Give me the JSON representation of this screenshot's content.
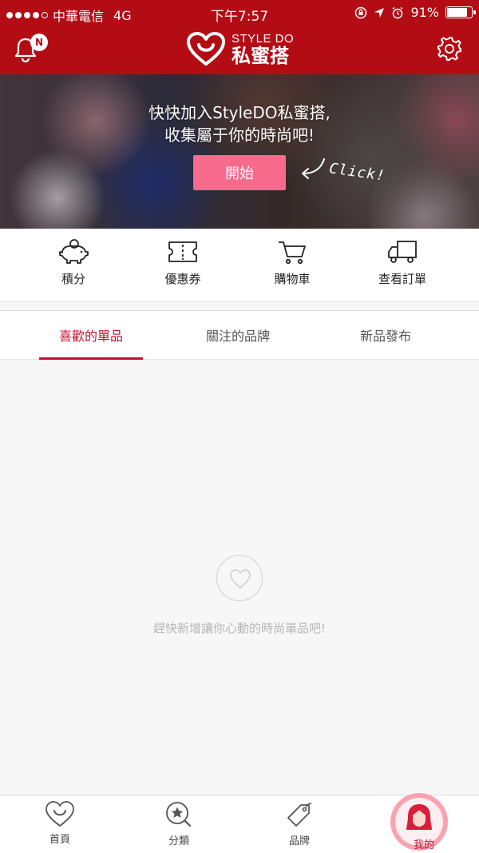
{
  "status_bar": {
    "carrier": "中華電信",
    "network": "4G",
    "time": "下午7:57",
    "battery": "91%",
    "battery_level": 0.91
  },
  "nav": {
    "notification_badge": "N",
    "logo_en": "STYLE DO",
    "logo_zh": "私蜜搭"
  },
  "banner": {
    "line1": "快快加入StyleDO私蜜搭,",
    "line2": "收集屬于你的時尚吧!",
    "start_button": "開始",
    "click_hint": "Click!"
  },
  "quick_actions": [
    {
      "label": "積分",
      "icon": "piggy-bank-icon"
    },
    {
      "label": "優惠券",
      "icon": "coupon-icon"
    },
    {
      "label": "購物車",
      "icon": "cart-icon"
    },
    {
      "label": "查看訂單",
      "icon": "truck-icon"
    }
  ],
  "tabs": [
    {
      "label": "喜歡的單品",
      "active": true
    },
    {
      "label": "關注的品牌",
      "active": false
    },
    {
      "label": "新品發布",
      "active": false
    }
  ],
  "empty_state": {
    "message": "趕快新增讓你心動的時尚單品吧!"
  },
  "bottom_nav": [
    {
      "label": "首頁",
      "icon": "home-heart-icon"
    },
    {
      "label": "分類",
      "icon": "search-star-icon"
    },
    {
      "label": "品牌",
      "icon": "tag-icon"
    },
    {
      "label": "我的",
      "icon": "avatar-icon",
      "active": true
    }
  ],
  "colors": {
    "brand_red": "#b40c14",
    "accent_red": "#c8102e",
    "button_pink": "#f76a8c"
  }
}
